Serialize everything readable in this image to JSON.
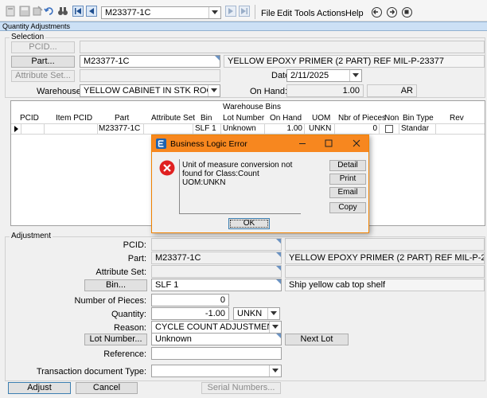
{
  "toolbar": {
    "part_value": "M23377-1C",
    "menus": [
      "File",
      "Edit",
      "Tools",
      "Actions",
      "Help"
    ]
  },
  "window": {
    "title": "Quantity Adjustments"
  },
  "selection": {
    "group_title": "Selection",
    "pcid_button": "PCID...",
    "part_button": "Part...",
    "part_value": "M23377-1C",
    "part_description": "YELLOW EPOXY PRIMER (2 PART) REF MIL-P-23377",
    "attribute_set_button": "Attribute Set...",
    "date_label": "Date:",
    "date_value": "2/11/2025",
    "warehouse_label": "Warehouse:",
    "warehouse_value": "YELLOW CABINET IN STK ROOM",
    "on_hand_label": "On Hand:",
    "on_hand_value": "1.00",
    "on_hand_uom": "AR"
  },
  "grid": {
    "title": "Warehouse Bins",
    "columns": [
      "PCID",
      "Item PCID",
      "Part",
      "Attribute Set",
      "Bin",
      "Lot Number",
      "On Hand",
      "UOM",
      "Nbr of Pieces",
      "Non",
      "Bin Type",
      "Rev"
    ],
    "row": {
      "part": "M23377-1C",
      "bin": "SLF 1",
      "lot": "Unknown",
      "on_hand": "1.00",
      "uom": "UNKN",
      "pieces": "0",
      "bin_type": "Standar"
    }
  },
  "dialog": {
    "title": "Business Logic Error",
    "message": "Unit of measure conversion not found for Class:Count  UOM:UNKN",
    "buttons": {
      "detail": "Detail",
      "print": "Print",
      "email": "Email",
      "copy": "Copy",
      "ok": "OK"
    }
  },
  "adjustment": {
    "group_title": "Adjustment",
    "pcid_label": "PCID:",
    "part_label": "Part:",
    "part_value": "M23377-1C",
    "part_description": "YELLOW EPOXY PRIMER (2 PART) REF MIL-P-23377",
    "attribute_set_label": "Attribute Set:",
    "bin_button": "Bin...",
    "bin_value": "SLF 1",
    "bin_description": "Ship yellow cab top shelf",
    "pieces_label": "Number of Pieces:",
    "pieces_value": "0",
    "quantity_label": "Quantity:",
    "quantity_value": "-1.00",
    "quantity_uom": "UNKN",
    "reason_label": "Reason:",
    "reason_value": "CYCLE COUNT ADJUSTMENT",
    "lot_button": "Lot Number...",
    "lot_value": "Unknown",
    "next_lot_button": "Next Lot",
    "reference_label": "Reference:",
    "transaction_label": "Transaction document Type:"
  },
  "footer": {
    "adjust_button": "Adjust",
    "cancel_button": "Cancel",
    "serial_button": "Serial Numbers..."
  }
}
